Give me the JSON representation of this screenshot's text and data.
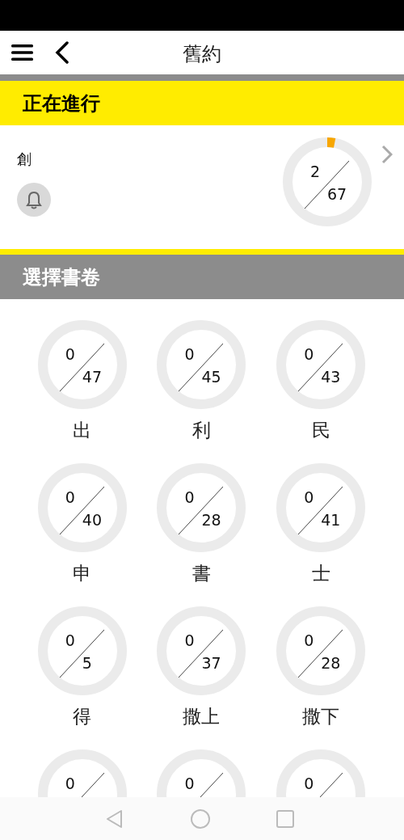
{
  "app_bar": {
    "title": "舊約"
  },
  "current": {
    "heading": "正在進行",
    "book": "創",
    "done": "2",
    "total": "67"
  },
  "books_section": {
    "heading": "選擇書卷",
    "books": [
      {
        "name": "出",
        "done": "0",
        "total": "47"
      },
      {
        "name": "利",
        "done": "0",
        "total": "45"
      },
      {
        "name": "民",
        "done": "0",
        "total": "43"
      },
      {
        "name": "申",
        "done": "0",
        "total": "40"
      },
      {
        "name": "書",
        "done": "0",
        "total": "28"
      },
      {
        "name": "士",
        "done": "0",
        "total": "41"
      },
      {
        "name": "得",
        "done": "0",
        "total": "5"
      },
      {
        "name": "撒上",
        "done": "0",
        "total": "37"
      },
      {
        "name": "撒下",
        "done": "0",
        "total": "28"
      },
      {
        "done": "0"
      },
      {
        "done": "0"
      },
      {
        "done": "0"
      }
    ]
  }
}
